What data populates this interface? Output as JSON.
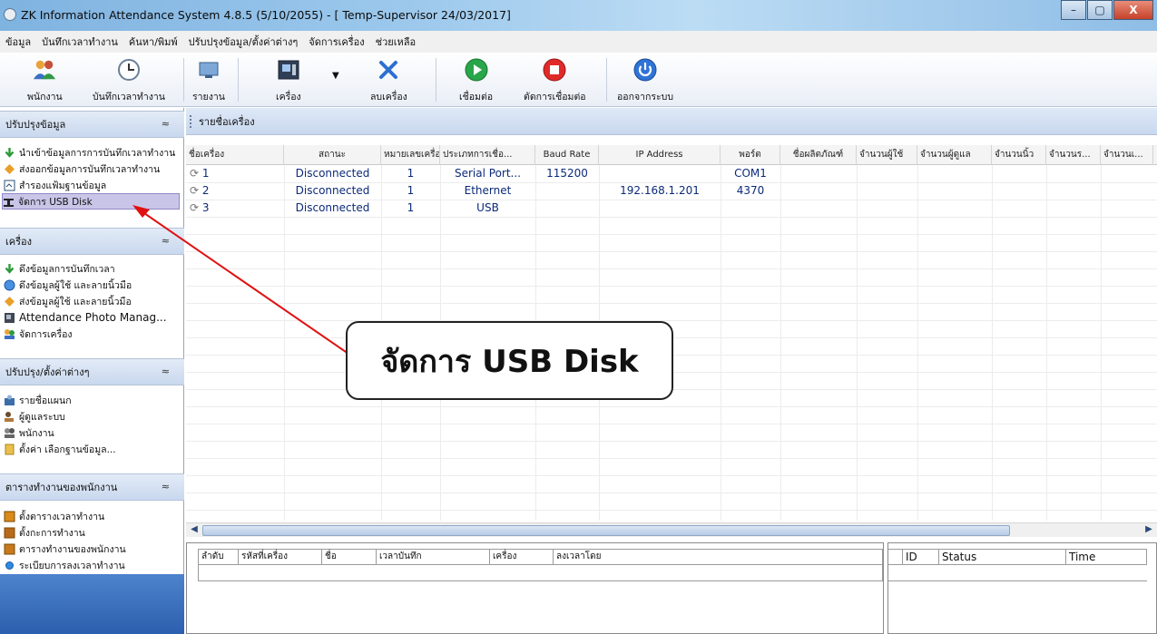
{
  "window": {
    "title": "ZK Information Attendance System 4.8.5 (5/10/2055) - [ Temp-Supervisor 24/03/2017]",
    "buttons": [
      "–",
      "▢",
      "X"
    ]
  },
  "menubar": [
    "ข้อมูล",
    "บันทึกเวลาทำงาน",
    "ค้นหา/พิมพ์",
    "ปรับปรุงข้อมูล/ตั้งค่าต่างๆ",
    "จัดการเครื่อง",
    "ช่วยเหลือ"
  ],
  "toolbar": {
    "employee": "พนักงาน",
    "attendance": "บันทึกเวลาทำงาน",
    "report": "รายงาน",
    "device": "เครื่อง",
    "delete_device": "ลบเครื่อง",
    "connect": "เชื่อมต่อ",
    "disconnect": "ตัดการเชื่อมต่อ",
    "exit": "ออกจากระบบ"
  },
  "sidebar": {
    "section1": {
      "title": "ปรับปรุงข้อมูล",
      "items": [
        "นำเข้าข้อมูลการการบันทึกเวลาทำงาน",
        "ส่งออกข้อมูลการบันทึกเวลาทำงาน",
        "สำรองแฟ้มฐานข้อมูล",
        "จัดการ USB Disk"
      ]
    },
    "section2": {
      "title": "เครื่อง",
      "items": [
        "ดึงข้อมูลการบันทึกเวลา",
        "ดึงข้อมูลผู้ใช้ และลายนิ้วมือ",
        "ส่งข้อมูลผู้ใช้ และลายนิ้วมือ",
        "Attendance Photo Manag...",
        "จัดการเครื่อง"
      ]
    },
    "section3": {
      "title": "ปรับปรุง/ตั้งค่าต่างๆ",
      "items": [
        "รายชื่อแผนก",
        "ผู้ดูแลระบบ",
        "พนักงาน",
        "ตั้งค่า เลือกฐานข้อมูล..."
      ]
    },
    "section4": {
      "title": "ตารางทำงานของพนักงาน",
      "items": [
        "ตั้งตารางเวลาทำงาน",
        "ตั้งกะการทำงาน",
        "ตารางทำงานของพนักงาน",
        "ระเบียบการลงเวลาทำงาน"
      ]
    }
  },
  "main": {
    "header": "รายชื่อเครื่อง",
    "columns": [
      "ชื่อเครื่อง",
      "สถานะ",
      "หมายเลขเครื่อง",
      "ประเภทการเชื่อ...",
      "Baud Rate",
      "IP Address",
      "พอร์ต",
      "ชื่อผลิตภัณฑ์",
      "จำนวนผู้ใช้",
      "จำนวนผู้ดูแล",
      "จำนวนนิ้ว",
      "จำนวนร...",
      "จำนวนเ..."
    ],
    "rows": [
      {
        "name": "1",
        "status": "Disconnected",
        "number": "1",
        "type": "Serial Port...",
        "baud": "115200",
        "ip": "",
        "port": "COM1"
      },
      {
        "name": "2",
        "status": "Disconnected",
        "number": "1",
        "type": "Ethernet",
        "baud": "",
        "ip": "192.168.1.201",
        "port": "4370"
      },
      {
        "name": "3",
        "status": "Disconnected",
        "number": "1",
        "type": "USB",
        "baud": "",
        "ip": "",
        "port": ""
      }
    ]
  },
  "bottom_left": {
    "columns": [
      "ลำดับ",
      "รหัสที่เครื่อง",
      "ชื่อ",
      "เวลาบันทึก",
      "เครื่อง",
      "ลงเวลาโดย"
    ]
  },
  "bottom_right": {
    "columns": [
      "ID",
      "Status",
      "Time"
    ]
  },
  "callout": "จัดการ USB Disk",
  "colors": {
    "accent": "#2c5fae",
    "arrow": "#e01010",
    "selection": "#c9c5e8"
  }
}
